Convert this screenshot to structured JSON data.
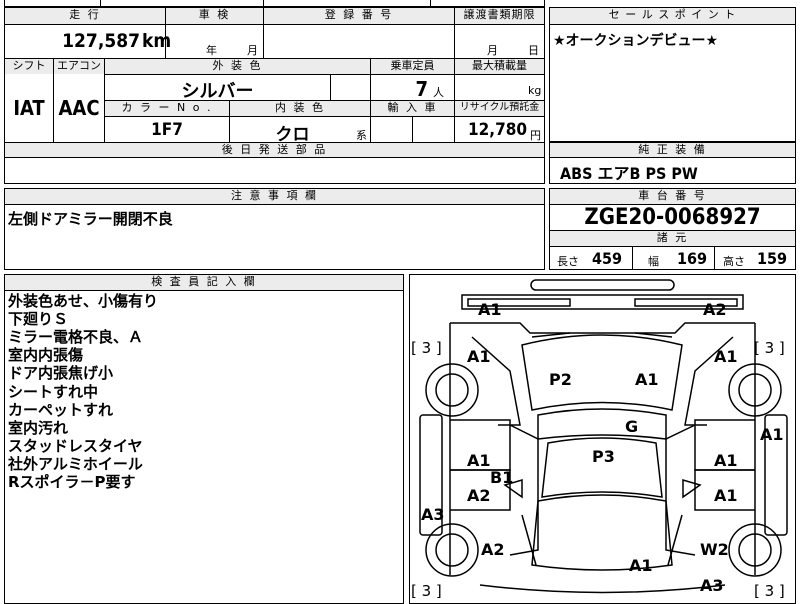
{
  "header": {
    "mileage_label": "走 行",
    "shaken_label": "車 検",
    "registration_label": "登 録 番 号",
    "transfer_deadline_label": "譲渡書類期限",
    "sales_point_label": "セ ー ル ス ポ イ ン ト"
  },
  "vehicle": {
    "mileage": "127,587",
    "mileage_unit": "km",
    "shaken_year_unit": "年",
    "shaken_month_unit": "月",
    "transfer_month_unit": "月",
    "transfer_day_unit": "日",
    "sales_point": "★オークションデビュー★",
    "shift_label": "シフト",
    "aircon_label": "エアコン",
    "exterior_color_label": "外 装 色",
    "capacity_label": "乗車定員",
    "max_load_label": "最大積載量",
    "shift": "IAT",
    "aircon": "AAC",
    "exterior_color": "シルバー",
    "capacity": "7",
    "capacity_unit": "人",
    "load_unit": "kg",
    "color_no_label": "カ ラ ー N o .",
    "interior_color_label": "内 装 色",
    "import_label": "輸 入 車",
    "recycle_label": "リサイクル預託金",
    "color_no": "1F7",
    "interior_color": "クロ",
    "interior_suffix": "系",
    "recycle_fee": "12,780",
    "recycle_unit": "円",
    "later_parts_label": "後 日 発 送 部 品",
    "genuine_equipment_label": "純 正 装 備",
    "genuine_equipment": "ABS エアB PS PW",
    "caution_label": "注 意 事 項 欄",
    "caution": "左側ドアミラー開閉不良",
    "chassis_label": "車 台 番 号",
    "chassis_number": "ZGE20-0068927",
    "specs_label": "諸 元",
    "length_label": "長さ",
    "length": "459",
    "width_label": "幅",
    "width": "169",
    "height_label": "高さ",
    "height": "159"
  },
  "inspector": {
    "label": "検 査 員 記 入 欄",
    "notes": [
      "外装色あせ、小傷有り",
      "下廻りＳ",
      "ミラー電格不良、Ａ",
      "室内内張傷",
      "ドア内張焦げ小",
      "シートすれ中",
      "カーペットすれ",
      "室内汚れ",
      "スタッドレスタイヤ",
      "社外アルミホイール",
      "Rスポイラ－P要す"
    ]
  },
  "damage_map": {
    "marks": [
      "A1",
      "A2",
      "A1",
      "A1",
      "P2",
      "A1",
      "G",
      "A1",
      "A1",
      "P3",
      "A1",
      "B1",
      "A2",
      "A1",
      "A3",
      "A2",
      "W2",
      "A1",
      "A3"
    ],
    "tires": [
      "[ 3 ]",
      "[ 3 ]",
      "[ 3 ]",
      "[ 3 ]"
    ]
  }
}
